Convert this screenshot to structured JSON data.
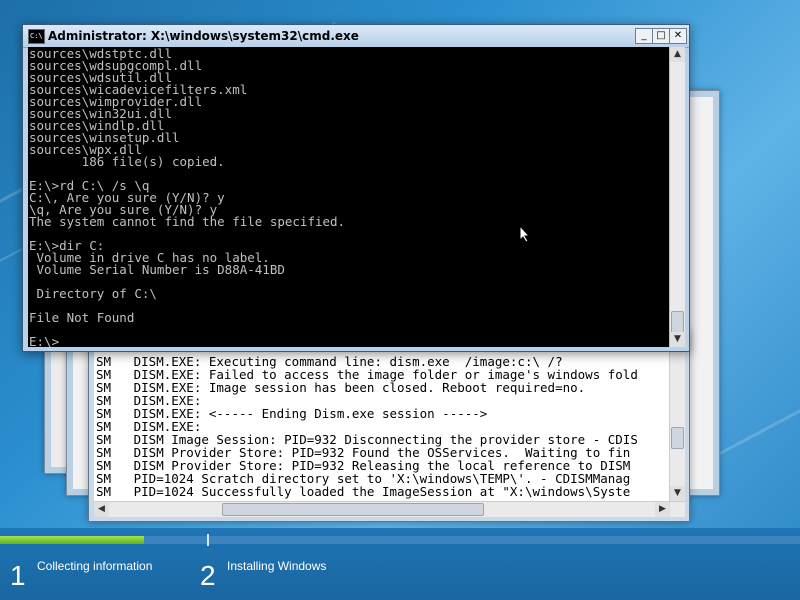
{
  "cmd_window": {
    "title": "Administrator: X:\\windows\\system32\\cmd.exe",
    "icon_text": "C:\\",
    "buttons": {
      "minimize": "_",
      "maximize": "□",
      "close": "✕"
    },
    "lines": [
      "sources\\wdstptc.dll",
      "sources\\wdsupgcompl.dll",
      "sources\\wdsutil.dll",
      "sources\\wicadevicefilters.xml",
      "sources\\wimprovider.dll",
      "sources\\win32ui.dll",
      "sources\\windlp.dll",
      "sources\\winsetup.dll",
      "sources\\wpx.dll",
      "       186 file(s) copied.",
      "",
      "E:\\>rd C:\\ /s \\q",
      "C:\\, Are you sure (Y/N)? y",
      "\\q, Are you sure (Y/N)? y",
      "The system cannot find the file specified.",
      "",
      "E:\\>dir C:",
      " Volume in drive C has no label.",
      " Volume Serial Number is D88A-41BD",
      "",
      " Directory of C:\\",
      "",
      "File Not Found",
      "",
      "E:\\>_"
    ]
  },
  "log_window": {
    "lines": [
      "SM   DISM.EXE: Executing command line: dism.exe  /image:c:\\ /?",
      "SM   DISM.EXE: Failed to access the image folder or image's windows fold",
      "SM   DISM.EXE: Image session has been closed. Reboot required=no.",
      "SM   DISM.EXE:",
      "SM   DISM.EXE: <----- Ending Dism.exe session ----->",
      "SM   DISM.EXE:",
      "SM   DISM Image Session: PID=932 Disconnecting the provider store - CDIS",
      "SM   DISM Provider Store: PID=932 Found the OSServices.  Waiting to fin",
      "SM   DISM Provider Store: PID=932 Releasing the local reference to DISM",
      "SM   PID=1024 Scratch directory set to 'X:\\windows\\TEMP\\'. - CDISMManag",
      "SM   PID=1024 Successfully loaded the ImageSession at \"X:\\windows\\Syste"
    ]
  },
  "setup": {
    "progress_fraction": 0.18,
    "steps": [
      {
        "number": "1",
        "label": "Collecting information"
      },
      {
        "number": "2",
        "label": "Installing Windows"
      }
    ]
  }
}
